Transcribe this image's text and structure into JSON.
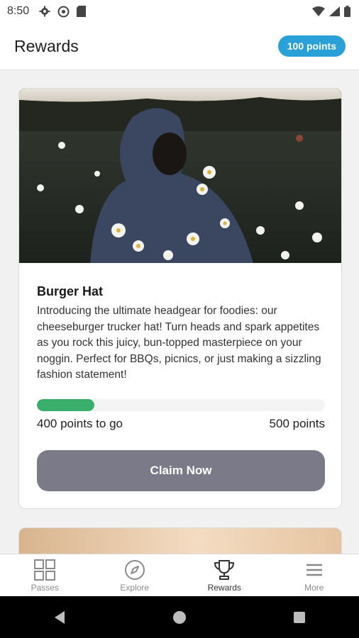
{
  "status_bar": {
    "time": "8:50"
  },
  "header": {
    "title": "Rewards",
    "points_badge": "100 points"
  },
  "reward": {
    "title": "Burger Hat",
    "description": "Introducing the ultimate headgear for foodies: our cheeseburger trucker hat! Turn heads and spark appetites as you rock this juicy, bun-topped masterpiece on your noggin. Perfect for BBQs, picnics, or just making a sizzling fashion statement!",
    "progress_fraction": 0.2,
    "points_to_go": "400 points to go",
    "points_required": "500 points",
    "claim_label": "Claim Now"
  },
  "bottom_nav": {
    "items": [
      {
        "label": "Passes",
        "icon": "grid-icon",
        "active": false
      },
      {
        "label": "Explore",
        "icon": "compass-icon",
        "active": false
      },
      {
        "label": "Rewards",
        "icon": "trophy-icon",
        "active": true
      },
      {
        "label": "More",
        "icon": "menu-icon",
        "active": false
      }
    ]
  },
  "colors": {
    "accent_badge": "#2aa1d6",
    "progress": "#3aaf6b",
    "claim_button": "#7b7a88"
  }
}
